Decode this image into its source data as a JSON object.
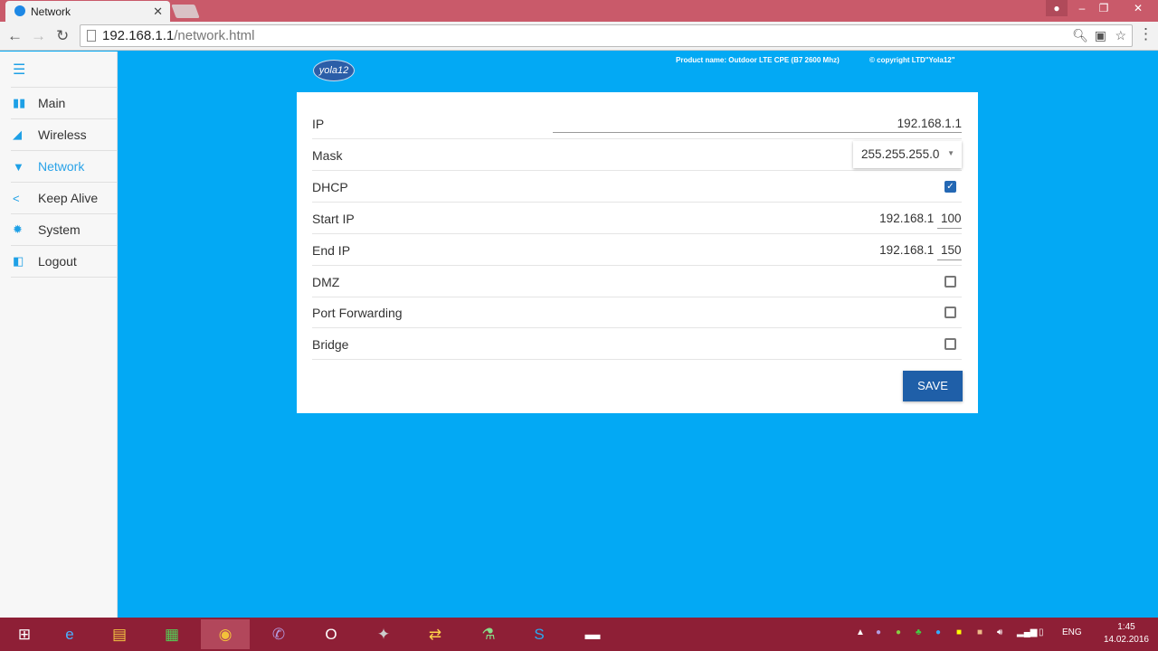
{
  "browser": {
    "tab_title": "Network",
    "url_host": "192.168.1.1",
    "url_path": "/network.html"
  },
  "sidebar": {
    "items": [
      {
        "label": "Main",
        "icon": "bar-chart-icon"
      },
      {
        "label": "Wireless",
        "icon": "signal-icon"
      },
      {
        "label": "Network",
        "icon": "wifi-icon",
        "active": true
      },
      {
        "label": "Keep Alive",
        "icon": "share-icon"
      },
      {
        "label": "System",
        "icon": "gear-icon"
      },
      {
        "label": "Logout",
        "icon": "logout-icon"
      }
    ]
  },
  "header": {
    "logo": "yola12",
    "product": "Product name: Outdoor LTE CPE (B7 2600 Mhz)",
    "copyright": "© copyright LTD\"Yola12\""
  },
  "form": {
    "ip_label": "IP",
    "ip_value": "192.168.1.1",
    "mask_label": "Mask",
    "mask_value": "255.255.255.0",
    "dhcp_label": "DHCP",
    "dhcp_checked": true,
    "start_label": "Start IP",
    "start_prefix": "192.168.1",
    "start_suffix": "100",
    "end_label": "End IP",
    "end_prefix": "192.168.1",
    "end_suffix": "150",
    "dmz_label": "DMZ",
    "dmz_checked": false,
    "pf_label": "Port Forwarding",
    "pf_checked": false,
    "bridge_label": "Bridge",
    "bridge_checked": false,
    "save_label": "SAVE"
  },
  "taskbar": {
    "lang": "ENG",
    "time": "1:45",
    "date": "14.02.2016"
  }
}
